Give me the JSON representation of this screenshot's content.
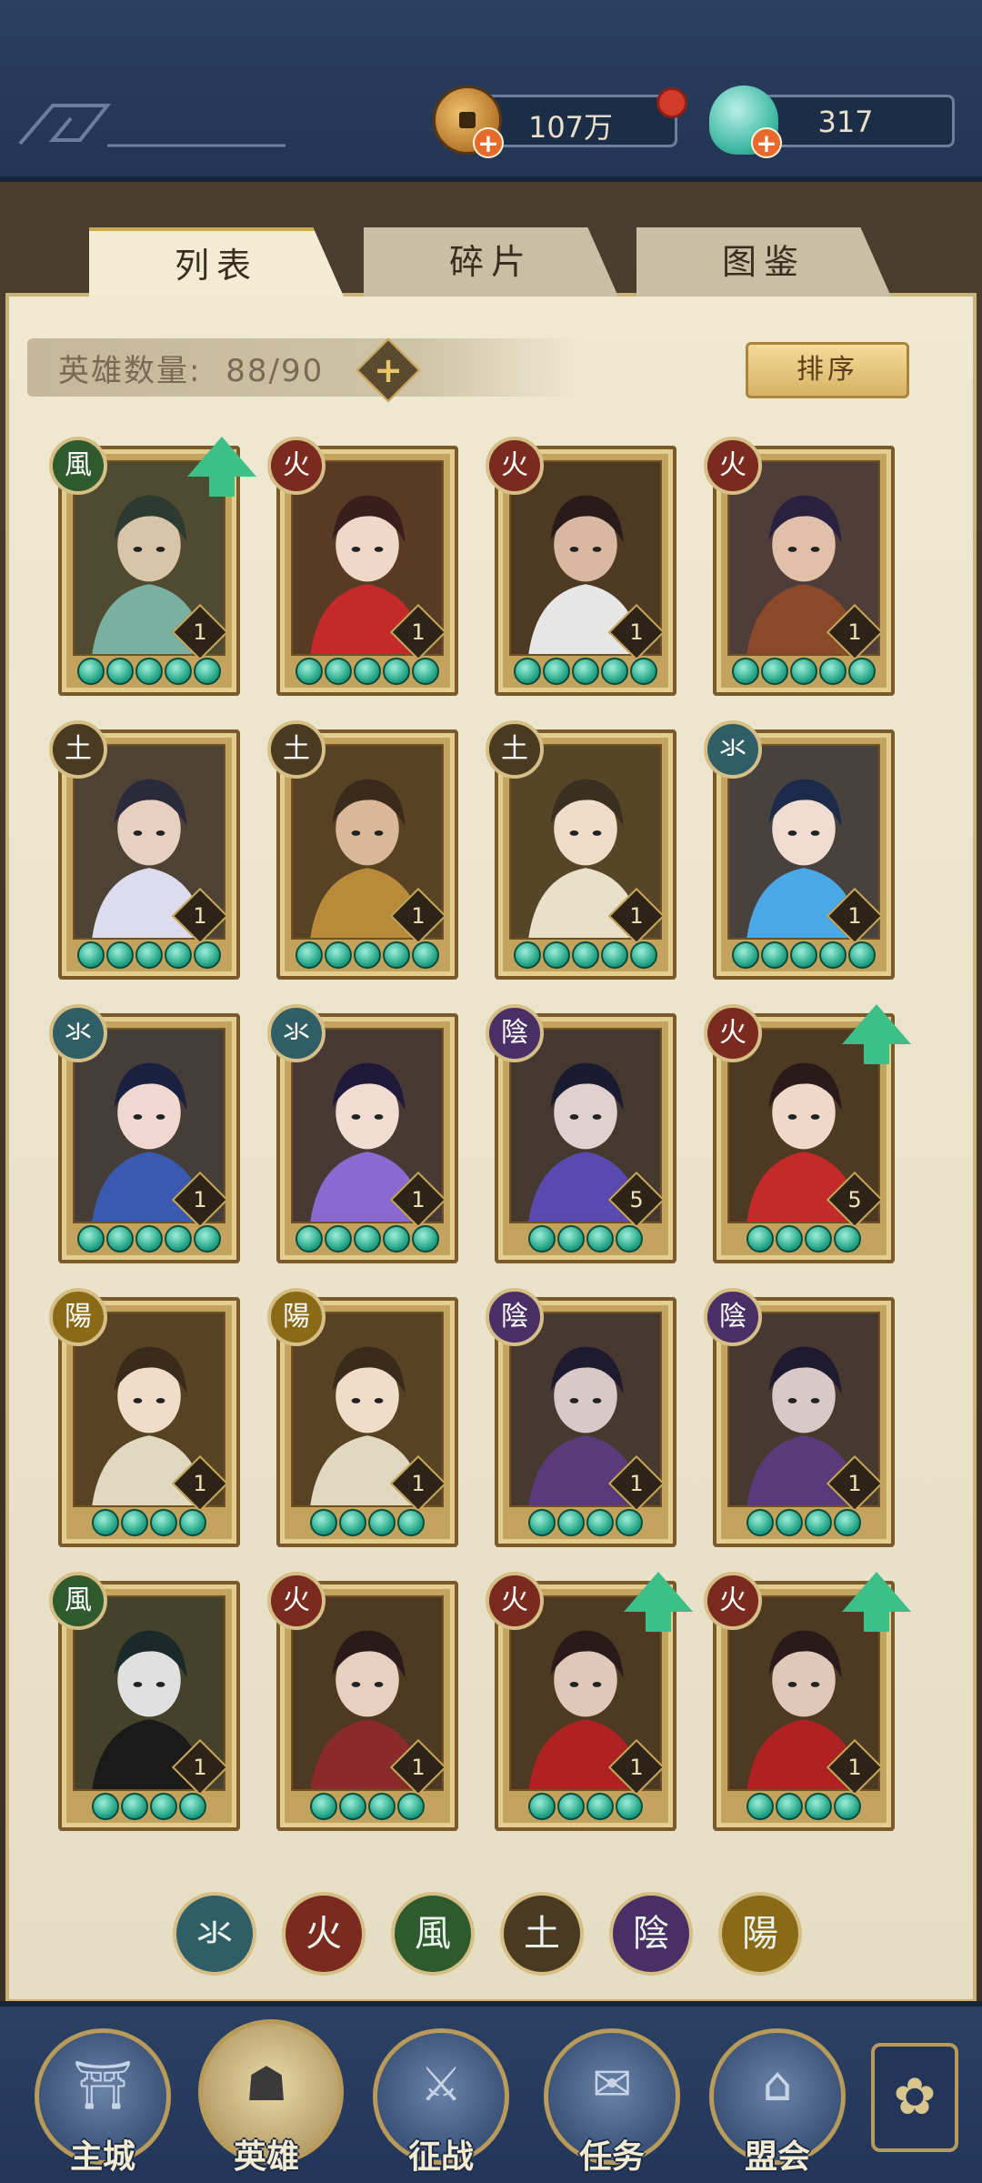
{
  "resources": {
    "coins": {
      "value": "107万",
      "icon": "copper-coin-icon"
    },
    "jade": {
      "value": "317",
      "icon": "jade-shell-icon"
    }
  },
  "tabs": [
    {
      "label": "列表",
      "active": true
    },
    {
      "label": "碎片",
      "active": false
    },
    {
      "label": "图鉴",
      "active": false
    }
  ],
  "hero_count": {
    "label": "英雄数量:",
    "value": "88/90"
  },
  "sort_label": "排序",
  "elements": {
    "water": {
      "glyph": "氺",
      "color": "#2f5e66"
    },
    "fire": {
      "glyph": "火",
      "color": "#7a2a1e"
    },
    "wind": {
      "glyph": "風",
      "color": "#2e5a2e"
    },
    "earth": {
      "glyph": "土",
      "color": "#4a3a22"
    },
    "yin": {
      "glyph": "陰",
      "color": "#4a2e66"
    },
    "yang": {
      "glyph": "陽",
      "color": "#8a6a16"
    }
  },
  "heroes": [
    {
      "element": "wind",
      "level": "1",
      "stars": 5,
      "upgrade": true,
      "palette": [
        "#2c3a32",
        "#7ab0a0",
        "#d8c4a8"
      ]
    },
    {
      "element": "fire",
      "level": "1",
      "stars": 5,
      "upgrade": false,
      "palette": [
        "#3a1e1e",
        "#c42a2a",
        "#f0d8c8"
      ]
    },
    {
      "element": "fire",
      "level": "1",
      "stars": 5,
      "upgrade": false,
      "palette": [
        "#2a1a1a",
        "#e6e6e6",
        "#d8b8a0"
      ]
    },
    {
      "element": "fire",
      "level": "1",
      "stars": 5,
      "upgrade": false,
      "palette": [
        "#2a2040",
        "#8a4a2a",
        "#e0c0a8"
      ]
    },
    {
      "element": "earth",
      "level": "1",
      "stars": 5,
      "upgrade": false,
      "palette": [
        "#2a2a3a",
        "#dcdcee",
        "#e8d0c0"
      ]
    },
    {
      "element": "earth",
      "level": "1",
      "stars": 5,
      "upgrade": false,
      "palette": [
        "#3a2a1a",
        "#b88a3a",
        "#d8b898"
      ]
    },
    {
      "element": "earth",
      "level": "1",
      "stars": 5,
      "upgrade": false,
      "palette": [
        "#3a3020",
        "#e8e0c8",
        "#f0dcc8"
      ]
    },
    {
      "element": "water",
      "level": "1",
      "stars": 5,
      "upgrade": false,
      "palette": [
        "#1e2a4a",
        "#4aa8e6",
        "#f0dcd0"
      ]
    },
    {
      "element": "water",
      "level": "1",
      "stars": 5,
      "upgrade": false,
      "palette": [
        "#1a2040",
        "#3a5ab0",
        "#f0d8d0"
      ]
    },
    {
      "element": "water",
      "level": "1",
      "stars": 5,
      "upgrade": false,
      "palette": [
        "#201a3a",
        "#8a6ad0",
        "#f0dcd0"
      ]
    },
    {
      "element": "yin",
      "level": "5",
      "stars": 4,
      "upgrade": false,
      "palette": [
        "#1a1a30",
        "#5a4ab0",
        "#e0d0d0"
      ]
    },
    {
      "element": "fire",
      "level": "5",
      "stars": 4,
      "upgrade": true,
      "palette": [
        "#2a1a1a",
        "#c42a2a",
        "#f0d8c8"
      ]
    },
    {
      "element": "yang",
      "level": "1",
      "stars": 4,
      "upgrade": false,
      "palette": [
        "#3a2a1a",
        "#e0d8c0",
        "#f0dcc8"
      ]
    },
    {
      "element": "yang",
      "level": "1",
      "stars": 4,
      "upgrade": false,
      "palette": [
        "#3a2a1a",
        "#e0d8c0",
        "#f0dcc8"
      ]
    },
    {
      "element": "yin",
      "level": "1",
      "stars": 4,
      "upgrade": false,
      "palette": [
        "#1e1a30",
        "#5a3a7a",
        "#d8c8c8"
      ]
    },
    {
      "element": "yin",
      "level": "1",
      "stars": 4,
      "upgrade": false,
      "palette": [
        "#1e1a30",
        "#5a3a7a",
        "#d8c8c8"
      ]
    },
    {
      "element": "wind",
      "level": "1",
      "stars": 4,
      "upgrade": false,
      "palette": [
        "#1a2a2a",
        "#1a1a1a",
        "#e0e0e0"
      ]
    },
    {
      "element": "fire",
      "level": "1",
      "stars": 4,
      "upgrade": false,
      "palette": [
        "#2a1a1a",
        "#8a2a2a",
        "#e8d0c0"
      ]
    },
    {
      "element": "fire",
      "level": "1",
      "stars": 4,
      "upgrade": true,
      "palette": [
        "#2a1a1a",
        "#b02222",
        "#e0c8b8"
      ]
    },
    {
      "element": "fire",
      "level": "1",
      "stars": 4,
      "upgrade": true,
      "palette": [
        "#2a1a1a",
        "#b02222",
        "#e0c8b8"
      ]
    }
  ],
  "filters": [
    "water",
    "fire",
    "wind",
    "earth",
    "yin",
    "yang"
  ],
  "nav": [
    {
      "label": "主城",
      "icon": "palace-icon",
      "glyph": "⛩",
      "active": false
    },
    {
      "label": "英雄",
      "icon": "hero-portrait-icon",
      "glyph": "☗",
      "active": true
    },
    {
      "label": "征战",
      "icon": "battle-icon",
      "glyph": "⚔",
      "active": false
    },
    {
      "label": "任务",
      "icon": "quest-scroll-icon",
      "glyph": "✉",
      "active": false
    },
    {
      "label": "盟会",
      "icon": "guild-hall-icon",
      "glyph": "⌂",
      "active": false
    }
  ],
  "menu_icon": "flower-menu-icon"
}
